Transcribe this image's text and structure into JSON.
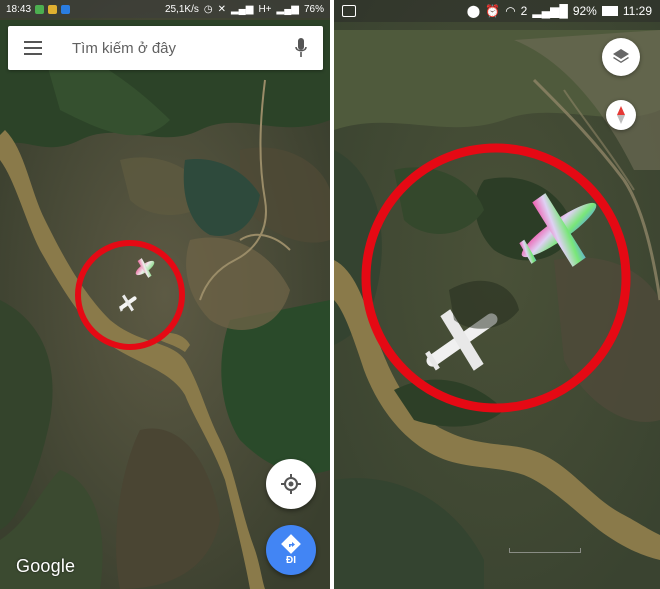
{
  "left_screen": {
    "status_bar": {
      "time": "18:43",
      "speed": "25,1K/s",
      "network": "H+",
      "battery": "76%"
    },
    "search": {
      "placeholder": "Tìm kiếm ở đây"
    },
    "directions_label": "ĐI",
    "logo_text": "Google"
  },
  "right_screen": {
    "status_bar": {
      "battery": "92%",
      "time": "11:29",
      "sim_slot": "2"
    }
  },
  "colors": {
    "highlight_circle": "#e50914",
    "directions_blue": "#4285f4",
    "river": "#8a7a4a",
    "forest": "#2f4a2a"
  },
  "icons": [
    "menu-icon",
    "mic-icon",
    "my-location-icon",
    "directions-icon",
    "layers-icon",
    "compass-icon",
    "wifi-icon",
    "location-pin-icon",
    "alarm-icon"
  ]
}
